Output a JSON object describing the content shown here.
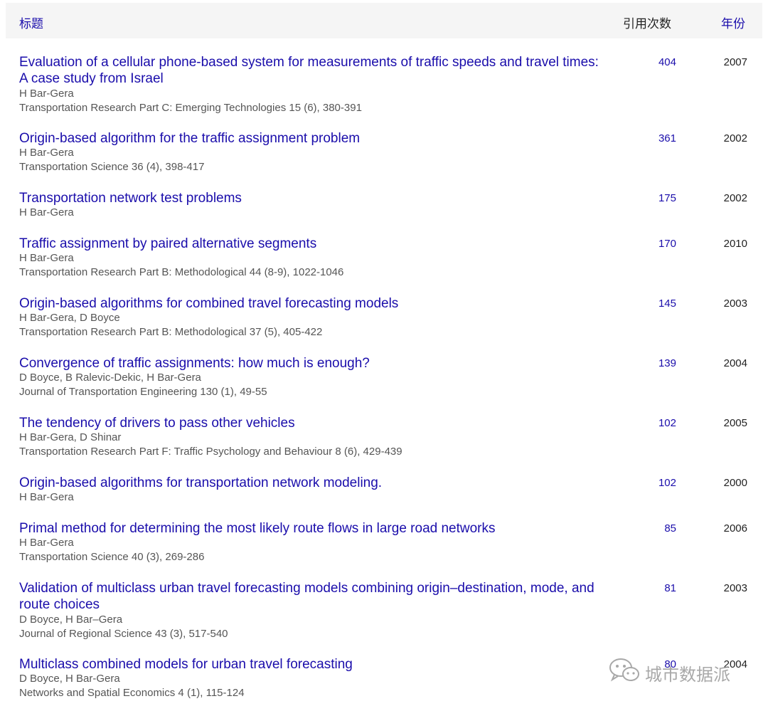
{
  "header": {
    "title_col": "标题",
    "cites_col": "引用次数",
    "year_col": "年份"
  },
  "rows": [
    {
      "title": "Evaluation of a cellular phone-based system for measurements of traffic speeds and travel times: A case study from Israel",
      "authors": "H Bar-Gera",
      "venue": "Transportation Research Part C: Emerging Technologies 15 (6), 380-391",
      "cites": "404",
      "year": "2007"
    },
    {
      "title": "Origin-based algorithm for the traffic assignment problem",
      "authors": "H Bar-Gera",
      "venue": "Transportation Science 36 (4), 398-417",
      "cites": "361",
      "year": "2002"
    },
    {
      "title": "Transportation network test problems",
      "authors": "H Bar-Gera",
      "venue": "",
      "cites": "175",
      "year": "2002"
    },
    {
      "title": "Traffic assignment by paired alternative segments",
      "authors": "H Bar-Gera",
      "venue": "Transportation Research Part B: Methodological 44 (8-9), 1022-1046",
      "cites": "170",
      "year": "2010"
    },
    {
      "title": "Origin-based algorithms for combined travel forecasting models",
      "authors": "H Bar-Gera, D Boyce",
      "venue": "Transportation Research Part B: Methodological 37 (5), 405-422",
      "cites": "145",
      "year": "2003"
    },
    {
      "title": "Convergence of traffic assignments: how much is enough?",
      "authors": "D Boyce, B Ralevic-Dekic, H Bar-Gera",
      "venue": "Journal of Transportation Engineering 130 (1), 49-55",
      "cites": "139",
      "year": "2004"
    },
    {
      "title": "The tendency of drivers to pass other vehicles",
      "authors": "H Bar-Gera, D Shinar",
      "venue": "Transportation Research Part F: Traffic Psychology and Behaviour 8 (6), 429-439",
      "cites": "102",
      "year": "2005"
    },
    {
      "title": "Origin-based algorithms for transportation network modeling.",
      "authors": "H Bar-Gera",
      "venue": "",
      "cites": "102",
      "year": "2000"
    },
    {
      "title": "Primal method for determining the most likely route flows in large road networks",
      "authors": "H Bar-Gera",
      "venue": "Transportation Science 40 (3), 269-286",
      "cites": "85",
      "year": "2006"
    },
    {
      "title": "Validation of multiclass urban travel forecasting models combining origin–destination, mode, and route choices",
      "authors": "D Boyce, H Bar–Gera",
      "venue": "Journal of Regional Science 43 (3), 517-540",
      "cites": "81",
      "year": "2003"
    },
    {
      "title": "Multiclass combined models for urban travel forecasting",
      "authors": "D Boyce, H Bar-Gera",
      "venue": "Networks and Spatial Economics 4 (1), 115-124",
      "cites": "80",
      "year": "2004"
    }
  ],
  "watermark": {
    "text": "城市数据派",
    "icon": "wechat-icon"
  }
}
